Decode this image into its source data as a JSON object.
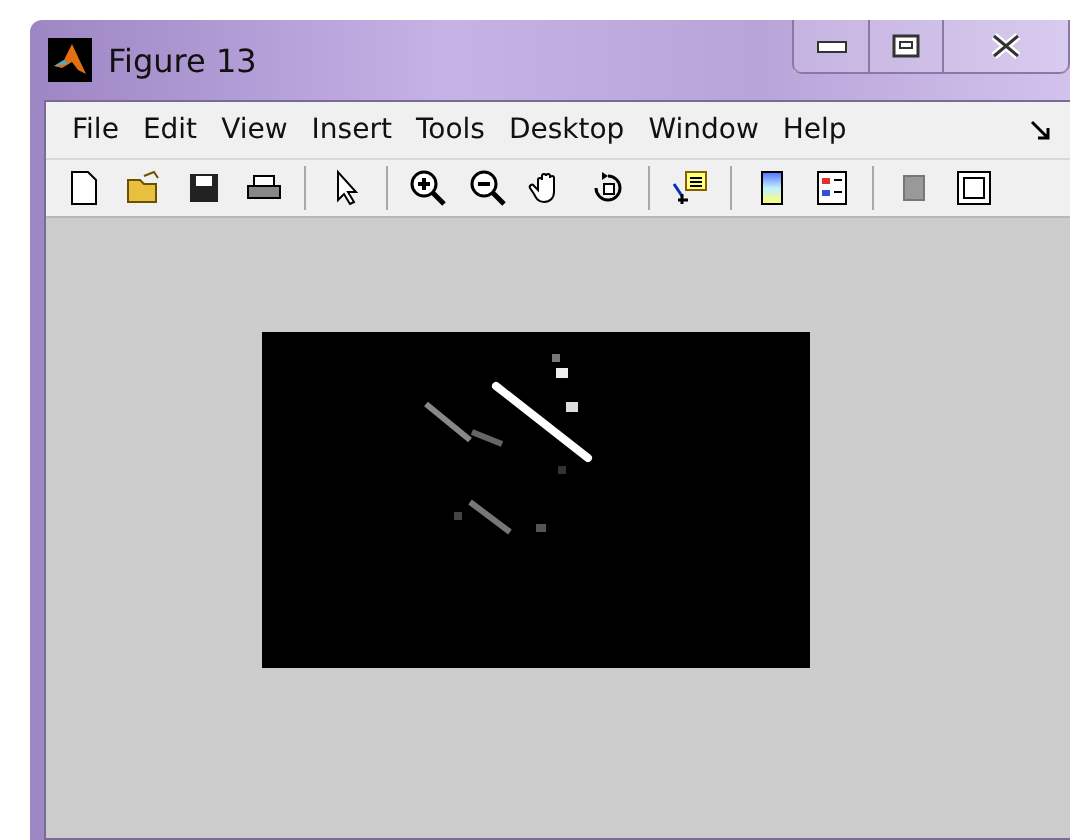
{
  "window": {
    "title": "Figure 13"
  },
  "menu": [
    {
      "label": "File"
    },
    {
      "label": "Edit"
    },
    {
      "label": "View"
    },
    {
      "label": "Insert"
    },
    {
      "label": "Tools"
    },
    {
      "label": "Desktop"
    },
    {
      "label": "Window"
    },
    {
      "label": "Help"
    }
  ],
  "toolbar": [
    {
      "kind": "new"
    },
    {
      "kind": "open"
    },
    {
      "kind": "save"
    },
    {
      "kind": "print"
    },
    {
      "kind": "sep"
    },
    {
      "kind": "pointer"
    },
    {
      "kind": "sep"
    },
    {
      "kind": "zoomin"
    },
    {
      "kind": "zoomout"
    },
    {
      "kind": "pan"
    },
    {
      "kind": "rotate"
    },
    {
      "kind": "sep"
    },
    {
      "kind": "datacursor"
    },
    {
      "kind": "sep"
    },
    {
      "kind": "colorbar"
    },
    {
      "kind": "legend"
    },
    {
      "kind": "sep"
    },
    {
      "kind": "hidetools"
    },
    {
      "kind": "showtools"
    }
  ]
}
